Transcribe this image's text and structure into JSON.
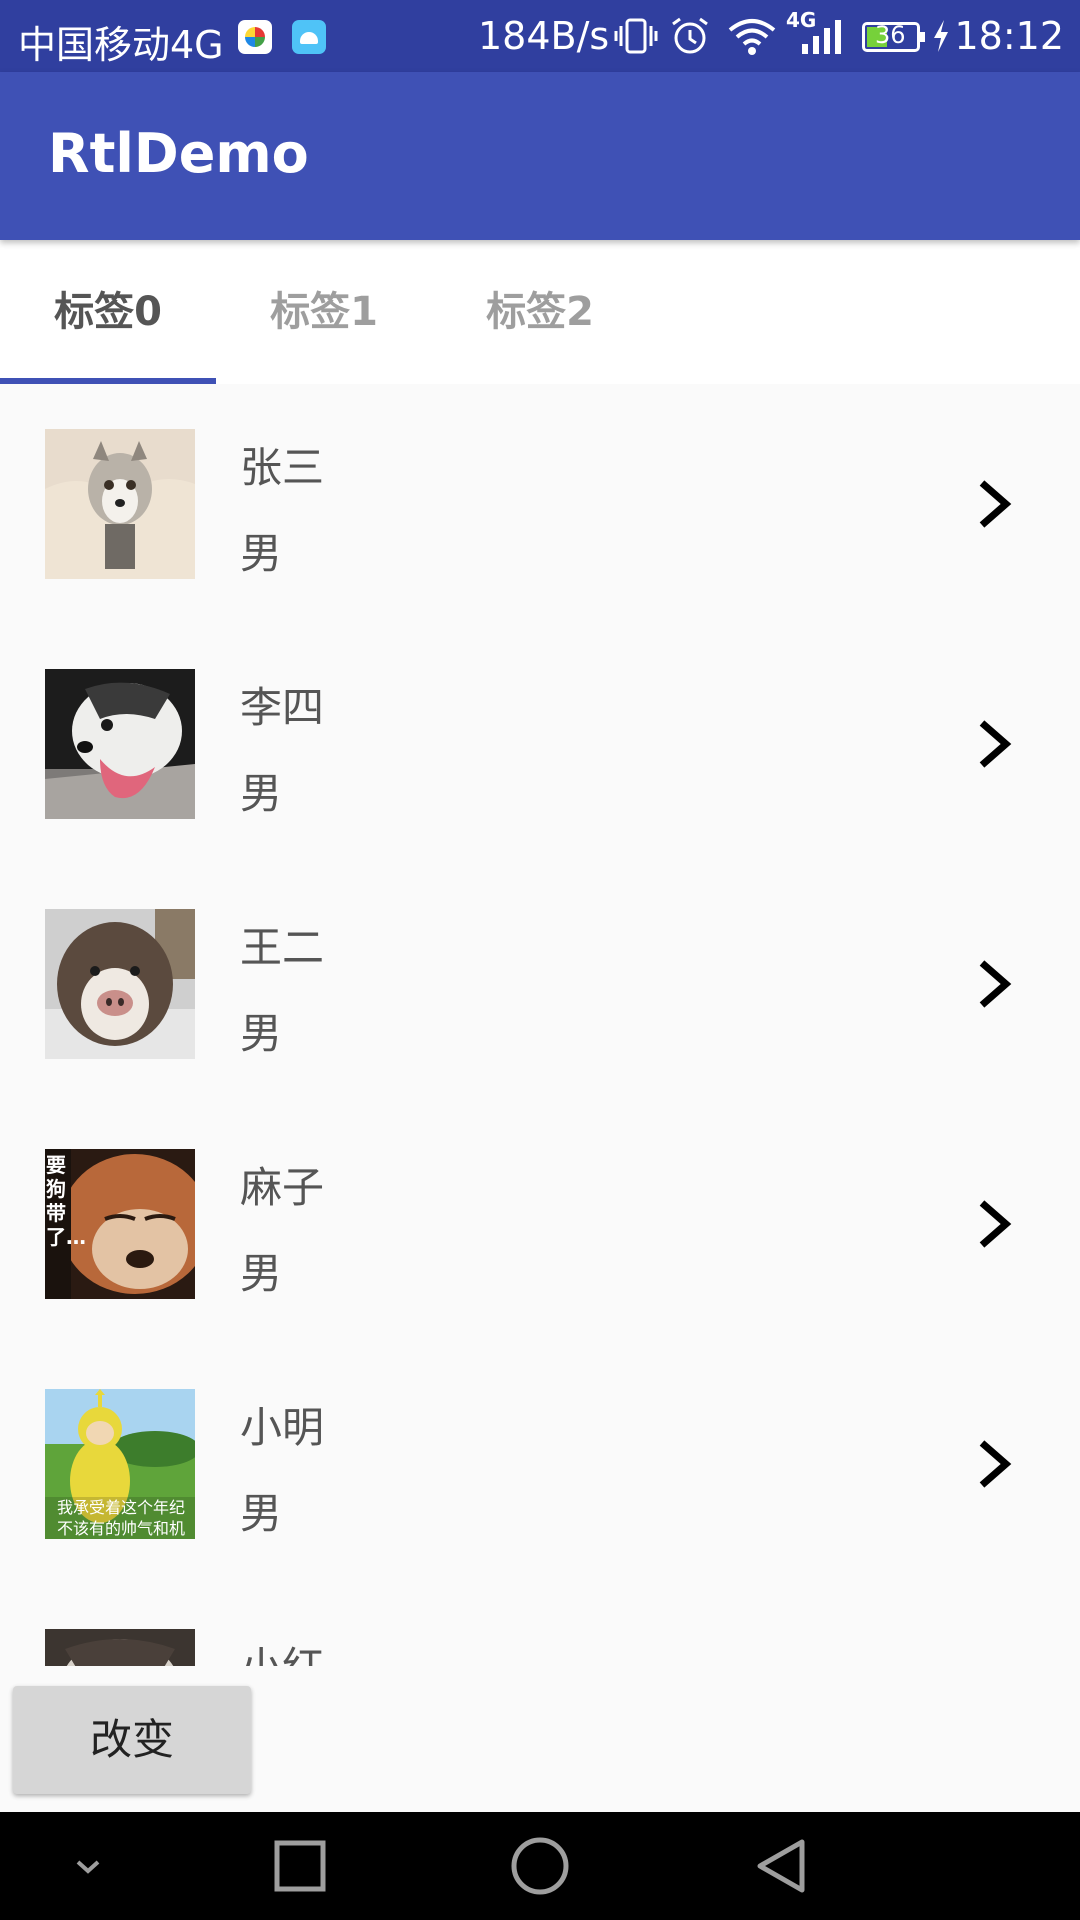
{
  "status_bar": {
    "carrier": "中国移动4G",
    "net_speed": "184B/s",
    "battery": "36",
    "time": "18:12",
    "signal_tag": "4G",
    "icons": [
      "colorful-app-icon",
      "android-debug-icon",
      "vibrate-icon",
      "alarm-icon",
      "wifi-icon",
      "signal-icon",
      "battery-icon",
      "charging-icon"
    ]
  },
  "app_bar": {
    "title": "RtlDemo",
    "color": "#3F51B5",
    "status_color": "#303F9F"
  },
  "tabs": [
    {
      "label": "标签0",
      "active": true
    },
    {
      "label": "标签1",
      "active": false
    },
    {
      "label": "标签2",
      "active": false
    }
  ],
  "list": {
    "items": [
      {
        "name": "张三",
        "gender": "男",
        "thumb": "husky-on-pillow"
      },
      {
        "name": "李四",
        "gender": "男",
        "thumb": "husky-tongue-out"
      },
      {
        "name": "王二",
        "gender": "男",
        "thumb": "husky-in-snow"
      },
      {
        "name": "麻子",
        "gender": "男",
        "thumb": "shiba-sleeping",
        "thumb_caption": "要狗带了…"
      },
      {
        "name": "小明",
        "gender": "男",
        "thumb": "teletubby-on-grass",
        "thumb_caption": "我承受着这个年纪不该有的帅气和机智"
      },
      {
        "name": "小红",
        "gender": "",
        "thumb": "husky-partial"
      }
    ],
    "chevron_icon": "chevron-right-icon"
  },
  "button": {
    "label": "改变"
  },
  "nav_bar": {
    "icons": [
      "chevron-down-icon",
      "recents-square-icon",
      "home-circle-icon",
      "back-triangle-icon"
    ]
  },
  "accent_color": "#3F51B5"
}
